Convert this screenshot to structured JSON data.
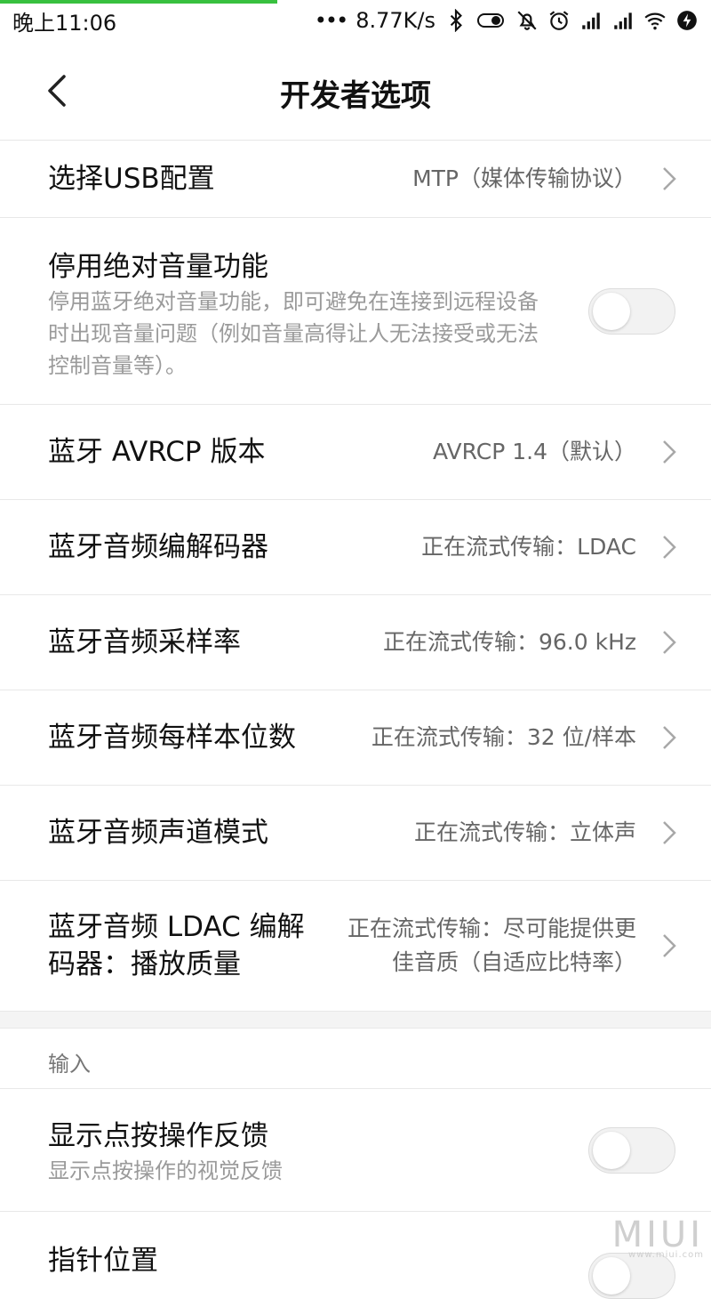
{
  "status_bar": {
    "time": "晚上11:06",
    "dots": "•••",
    "net_speed": "8.77K/s",
    "icons": [
      "bluetooth-icon",
      "battery-saver-icon",
      "mute-icon",
      "alarm-icon",
      "signal-icon",
      "signal-icon",
      "wifi-icon",
      "charging-icon"
    ],
    "progress_fraction": 0.39
  },
  "header": {
    "title": "开发者选项"
  },
  "rows": [
    {
      "title": "选择USB配置",
      "value": "MTP（媒体传输协议）"
    },
    {
      "title": "停用绝对音量功能",
      "desc": "停用蓝牙绝对音量功能，即可避免在连接到远程设备时出现音量问题（例如音量高得让人无法接受或无法控制音量等）。",
      "toggle": "off"
    },
    {
      "title": "蓝牙 AVRCP 版本",
      "value": "AVRCP 1.4（默认）"
    },
    {
      "title": "蓝牙音频编解码器",
      "value": "正在流式传输：LDAC"
    },
    {
      "title": "蓝牙音频采样率",
      "value": "正在流式传输：96.0 kHz"
    },
    {
      "title": "蓝牙音频每样本位数",
      "value": "正在流式传输：32 位/样本"
    },
    {
      "title": "蓝牙音频声道模式",
      "value": "正在流式传输：立体声"
    },
    {
      "title": "蓝牙音频 LDAC 编解码器：播放质量",
      "value": "正在流式传输：尽可能提供更佳音质（自适应比特率）"
    }
  ],
  "section": {
    "label": "输入"
  },
  "input_rows": [
    {
      "title": "显示点按操作反馈",
      "desc": "显示点按操作的视觉反馈",
      "toggle": "off"
    },
    {
      "title": "指针位置"
    }
  ],
  "watermark": {
    "text": "MIUI",
    "sub": "www.miui.com"
  },
  "colors": {
    "accent": "#38c03f",
    "divider": "#e8e8e8",
    "secondary_text": "#9a9a9a"
  }
}
